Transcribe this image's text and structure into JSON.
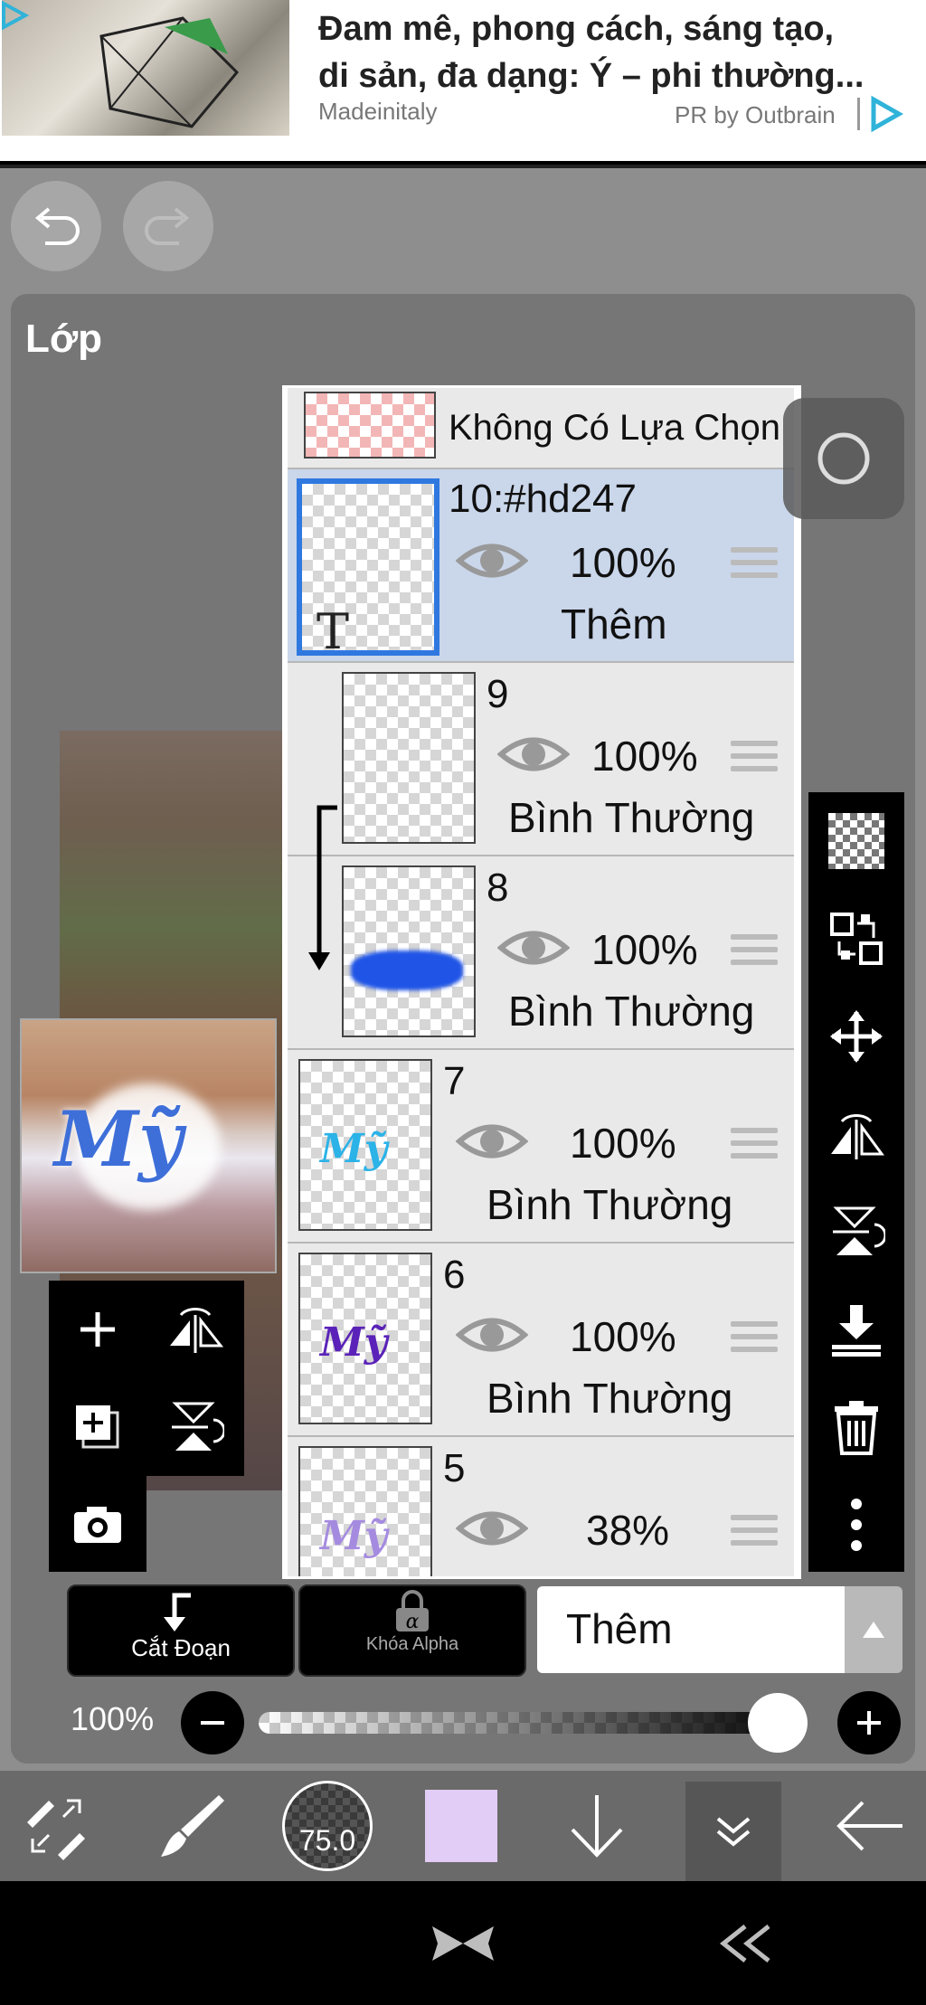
{
  "ad": {
    "headline": "Đam mê, phong cách, sáng tạo, di sản, đa dạng: Ý – phi thường...",
    "headline_line1": "Đam mê, phong cách, sáng tạo,",
    "headline_line2": "di sản, đa dạng: Ý – phi thường...",
    "source": "Madeinitaly",
    "sponsor": "PR by Outbrain"
  },
  "panel": {
    "title": "Lớp"
  },
  "layers": [
    {
      "name": "Không Có Lựa Chọn",
      "type": "selection"
    },
    {
      "name": "10:#hd247",
      "opacity": "100%",
      "blend": "Thêm",
      "selected": true,
      "text_layer_glyph": "T"
    },
    {
      "name": "9",
      "opacity": "100%",
      "blend": "Bình Thường",
      "clipped": true
    },
    {
      "name": "8",
      "opacity": "100%",
      "blend": "Bình Thường",
      "clipped": true
    },
    {
      "name": "7",
      "opacity": "100%",
      "blend": "Bình Thường",
      "thumb_text": "Mỹ",
      "thumb_color": "#2bb3e8"
    },
    {
      "name": "6",
      "opacity": "100%",
      "blend": "Bình Thường",
      "thumb_text": "Mỹ",
      "thumb_color": "#5a22b8"
    },
    {
      "name": "5",
      "opacity": "38%",
      "thumb_text": "Mỹ",
      "thumb_color": "#a58be0"
    }
  ],
  "canvas_preview": {
    "thumb_text": "Mỹ"
  },
  "blend_bar": {
    "clip_label": "Cắt Đoạn",
    "alpha_label": "Khóa Alpha",
    "mode_value": "Thêm"
  },
  "opacity": {
    "label": "100%",
    "value": 1.0
  },
  "brush": {
    "size": "75.0"
  },
  "colors": {
    "current": "#e2cdf6",
    "accent_blue": "#2f78e0",
    "selected_row": "#cad6ea"
  }
}
